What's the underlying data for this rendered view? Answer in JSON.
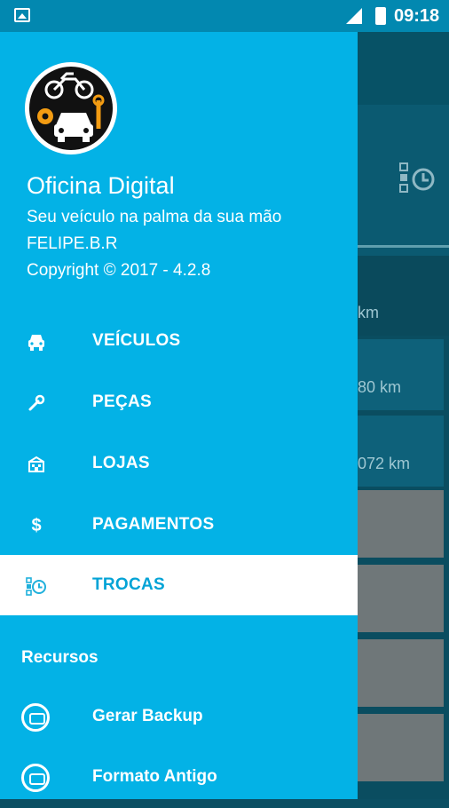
{
  "status_bar": {
    "time": "09:18"
  },
  "drawer": {
    "app_title": "Oficina Digital",
    "subtitle": "Seu veículo na palma da sua mão",
    "user": "FELIPE.B.R",
    "copyright": "Copyright © 2017 - 4.2.8",
    "menu_items": [
      {
        "label": "VEÍCULOS",
        "icon": "car-front-icon",
        "active": false
      },
      {
        "label": "PEÇAS",
        "icon": "wrench-icon",
        "active": false
      },
      {
        "label": "LOJAS",
        "icon": "store-icon",
        "active": false
      },
      {
        "label": "PAGAMENTOS",
        "icon": "dollar-icon",
        "active": false
      },
      {
        "label": "TROCAS",
        "icon": "history-clock-icon",
        "active": true
      }
    ],
    "resources_title": "Recursos",
    "resources": [
      {
        "label": "Gerar Backup",
        "icon": "backup-car-icon"
      },
      {
        "label": "Formato Antigo",
        "icon": "old-format-car-icon"
      }
    ]
  },
  "background": {
    "km_values": [
      "km",
      "80 km",
      "072 km"
    ]
  },
  "colors": {
    "drawer_bg": "#03b2e6",
    "status_bar": "#0288b0",
    "active_bg": "#ffffff",
    "active_text": "#03a3d6"
  }
}
